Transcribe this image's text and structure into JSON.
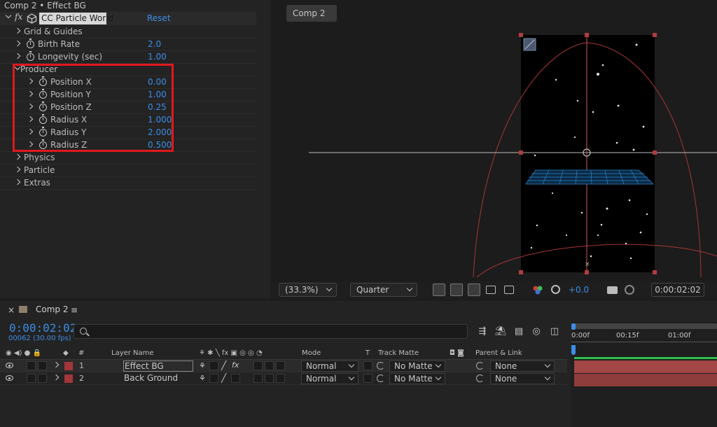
{
  "effect_controls": {
    "title": "Comp 2 • Effect BG",
    "effect": {
      "fx_label": "fx",
      "name": "CC Particle World",
      "reset": "Reset"
    },
    "rows": [
      {
        "label": "Grid & Guides",
        "value": ""
      },
      {
        "label": "Birth Rate",
        "value": "2.0"
      },
      {
        "label": "Longevity (sec)",
        "value": "1.00"
      },
      {
        "label": "Producer",
        "value": ""
      },
      {
        "label": "Position X",
        "value": "0.00"
      },
      {
        "label": "Position Y",
        "value": "1.00"
      },
      {
        "label": "Position Z",
        "value": "0.25"
      },
      {
        "label": "Radius X",
        "value": "1.000"
      },
      {
        "label": "Radius Y",
        "value": "2.000"
      },
      {
        "label": "Radius Z",
        "value": "0.500"
      },
      {
        "label": "Physics",
        "value": ""
      },
      {
        "label": "Particle",
        "value": ""
      },
      {
        "label": "Extras",
        "value": ""
      }
    ],
    "highlight_color": "#e0191d"
  },
  "viewer": {
    "tab": "Comp 2",
    "zoom": "(33.3%)",
    "resolution": "Quarter",
    "exposure": "+0.0",
    "timecode": "0:00:02:02",
    "accent": "#3d8ee6"
  },
  "timeline": {
    "comp_name": "Comp 2",
    "current_time": "0:00:02:02",
    "frame_info": "00062 (30.00 fps)",
    "headers": {
      "num": "#",
      "layer_name": "Layer Name",
      "mode": "Mode",
      "t": "T",
      "track_matte": "Track Matte",
      "parent": "Parent & Link"
    },
    "layers": [
      {
        "num": "1",
        "name": "Effect BG",
        "mode": "Normal",
        "matte": "No Matte",
        "parent": "None"
      },
      {
        "num": "2",
        "name": "Back Ground",
        "mode": "Normal",
        "matte": "No Matte",
        "parent": "None"
      }
    ],
    "ruler": [
      "0:00f",
      "00:15f",
      "01:00f"
    ],
    "layer_color": "#a3363a"
  }
}
